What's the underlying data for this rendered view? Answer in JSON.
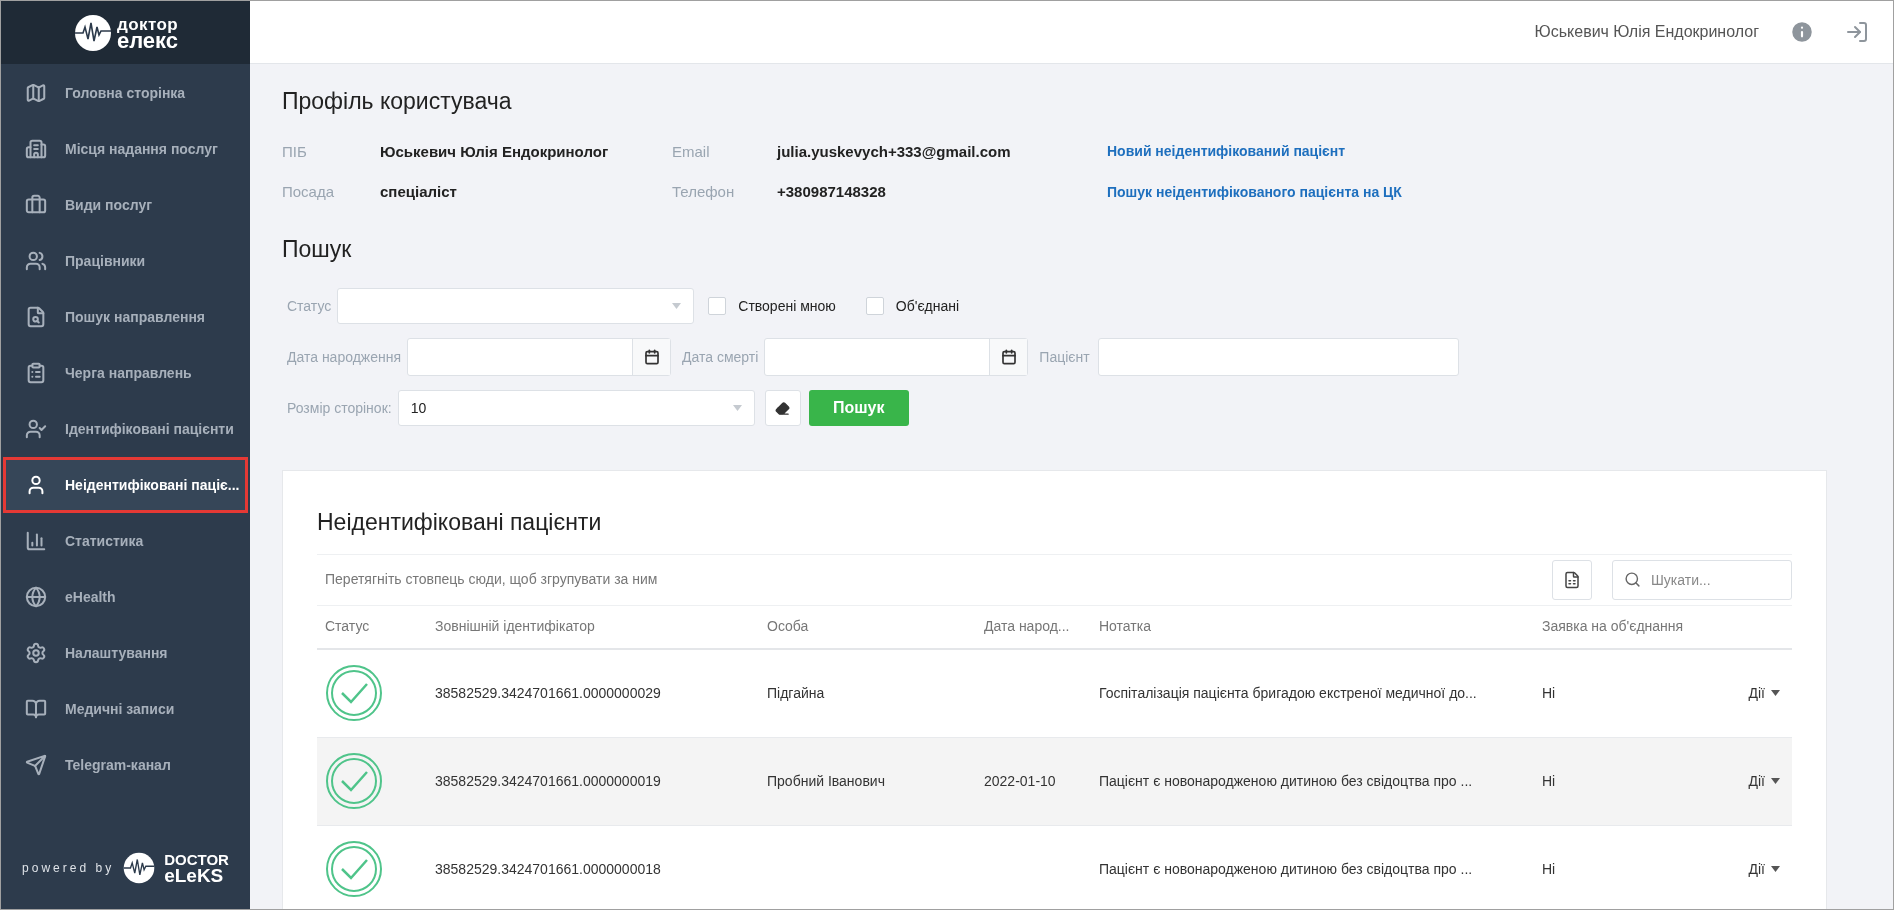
{
  "logo": {
    "line1": "доктор",
    "line2": "елекс"
  },
  "sidebar": {
    "items": [
      {
        "label": "Головна сторінка",
        "selected": false
      },
      {
        "label": "Місця надання послуг",
        "selected": false
      },
      {
        "label": "Види послуг",
        "selected": false
      },
      {
        "label": "Працівники",
        "selected": false
      },
      {
        "label": "Пошук направлення",
        "selected": false
      },
      {
        "label": "Черга направлень",
        "selected": false
      },
      {
        "label": "Ідентифіковані пацієнти",
        "selected": false
      },
      {
        "label": "Неідентифіковані паціє...",
        "selected": true
      },
      {
        "label": "Статистика",
        "selected": false
      },
      {
        "label": "eHealth",
        "selected": false
      },
      {
        "label": "Налаштування",
        "selected": false
      },
      {
        "label": "Медичні записи",
        "selected": false
      },
      {
        "label": "Telegram-канал",
        "selected": false
      }
    ],
    "footer": {
      "powered": "powered by",
      "brand1": "DOCTOR",
      "brand2": "eLeKS"
    }
  },
  "header": {
    "user": "Юськевич Юлія Ендокринолог"
  },
  "profile": {
    "title": "Профіль користувача",
    "fields": [
      {
        "label": "ПІБ",
        "value": "Юськевич Юлія Ендокринолог"
      },
      {
        "label": "Email",
        "value": "julia.yuskevych+333@gmail.com"
      },
      {
        "label": "Посада",
        "value": "спеціаліст"
      },
      {
        "label": "Телефон",
        "value": "+380987148328"
      }
    ],
    "links": [
      "Новий неідентифікований пацієнт",
      "Пошук неідентифікованого пацієнта на ЦК"
    ]
  },
  "search": {
    "title": "Пошук",
    "status_label": "Статус",
    "checkboxes": [
      {
        "label": "Створені мною",
        "checked": false
      },
      {
        "label": "Об'єднані",
        "checked": false
      }
    ],
    "birth_label": "Дата народження",
    "death_label": "Дата смерті",
    "patient_label": "Пацієнт",
    "page_size_label": "Розмір сторінок:",
    "page_size": "10",
    "search_button": "Пошук"
  },
  "table": {
    "title": "Неідентифіковані пацієнти",
    "group_hint": "Перетягніть стовпець сюди, щоб згрупувати за ним",
    "search_placeholder": "Шукати...",
    "columns": [
      "Статус",
      "Зовнішній ідентифікатор",
      "Особа",
      "Дата народ...",
      "Нотатка",
      "Заявка на об'єднання"
    ],
    "rows": [
      {
        "id": "38582529.3424701661.0000000029",
        "person": "Підгайна",
        "birth": "",
        "note": "Госпіталізація пацієнта бригадою екстреної медичної до...",
        "merge": "Ні",
        "actions": "Дії"
      },
      {
        "id": "38582529.3424701661.0000000019",
        "person": "Пробний Іванович",
        "birth": "2022-01-10",
        "note": "Пацієнт є новонародженою дитиною без свідоцтва про ...",
        "merge": "Ні",
        "actions": "Дії"
      },
      {
        "id": "38582529.3424701661.0000000018",
        "person": "",
        "birth": "",
        "note": "Пацієнт є новонародженою дитиною без свідоцтва про ...",
        "merge": "Ні",
        "actions": "Дії"
      }
    ]
  }
}
